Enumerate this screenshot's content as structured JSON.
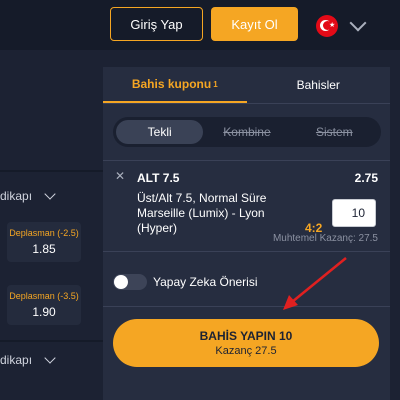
{
  "header": {
    "login_label": "Giriş Yap",
    "register_label": "Kayıt Ol",
    "language_flag": "turkey-flag-icon"
  },
  "left_panel": {
    "groups": [
      {
        "label": "dikapı"
      },
      {
        "label": "dikapı"
      }
    ],
    "odds": [
      {
        "label": "Deplasman (-2.5)",
        "value": "1.85"
      },
      {
        "label": "Deplasman (-3.5)",
        "value": "1.90"
      }
    ]
  },
  "betslip": {
    "tabs": [
      {
        "label": "Bahis kuponu",
        "count": "1"
      },
      {
        "label": "Bahisler"
      }
    ],
    "types": [
      "Tekli",
      "Kombine",
      "Sistem"
    ],
    "bet": {
      "market": "ALT 7.5",
      "odd": "2.75",
      "description": "Üst/Alt 7.5, Normal Süre Marseille (Lumix) - Lyon (Hyper)",
      "score": "4:2",
      "stake": "10",
      "potential_win": "Muhtemel Kazanç: 27.5"
    },
    "ai_label": "Yapay Zeka Önerisi",
    "place_bet": {
      "label": "BAHİS YAPIN  10",
      "win": "Kazanç 27.5"
    }
  },
  "colors": {
    "accent": "#f5a623",
    "background": "#1c2233",
    "panel": "#262d40",
    "arrow": "#e02020"
  }
}
